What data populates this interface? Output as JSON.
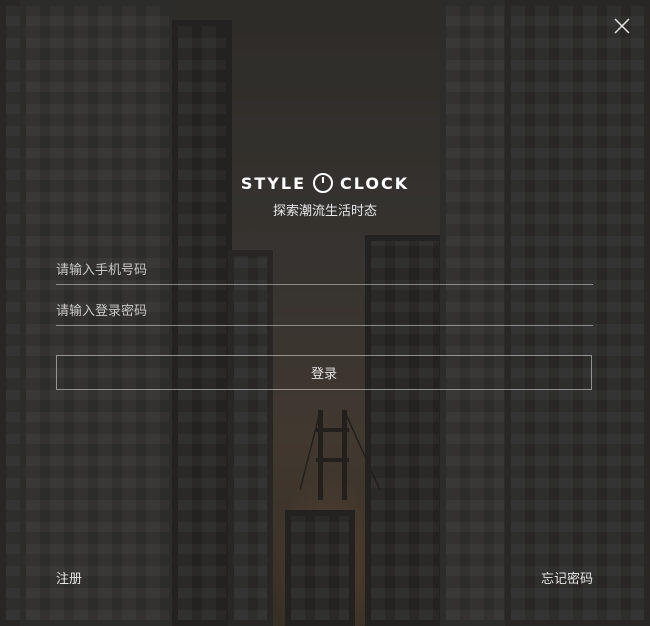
{
  "window": {
    "close_icon": "close-icon"
  },
  "brand": {
    "logo_left": "STYLE",
    "logo_right": "CLOCK",
    "logo_icon": "clock-icon",
    "tagline": "探索潮流生活时态"
  },
  "form": {
    "phone_placeholder": "请输入手机号码",
    "password_placeholder": "请输入登录密码",
    "login_label": "登录"
  },
  "footer": {
    "register_label": "注册",
    "forgot_label": "忘记密码"
  },
  "colors": {
    "text": "#ffffff",
    "border": "#d2d2d2",
    "background": "#2a2a2a"
  }
}
